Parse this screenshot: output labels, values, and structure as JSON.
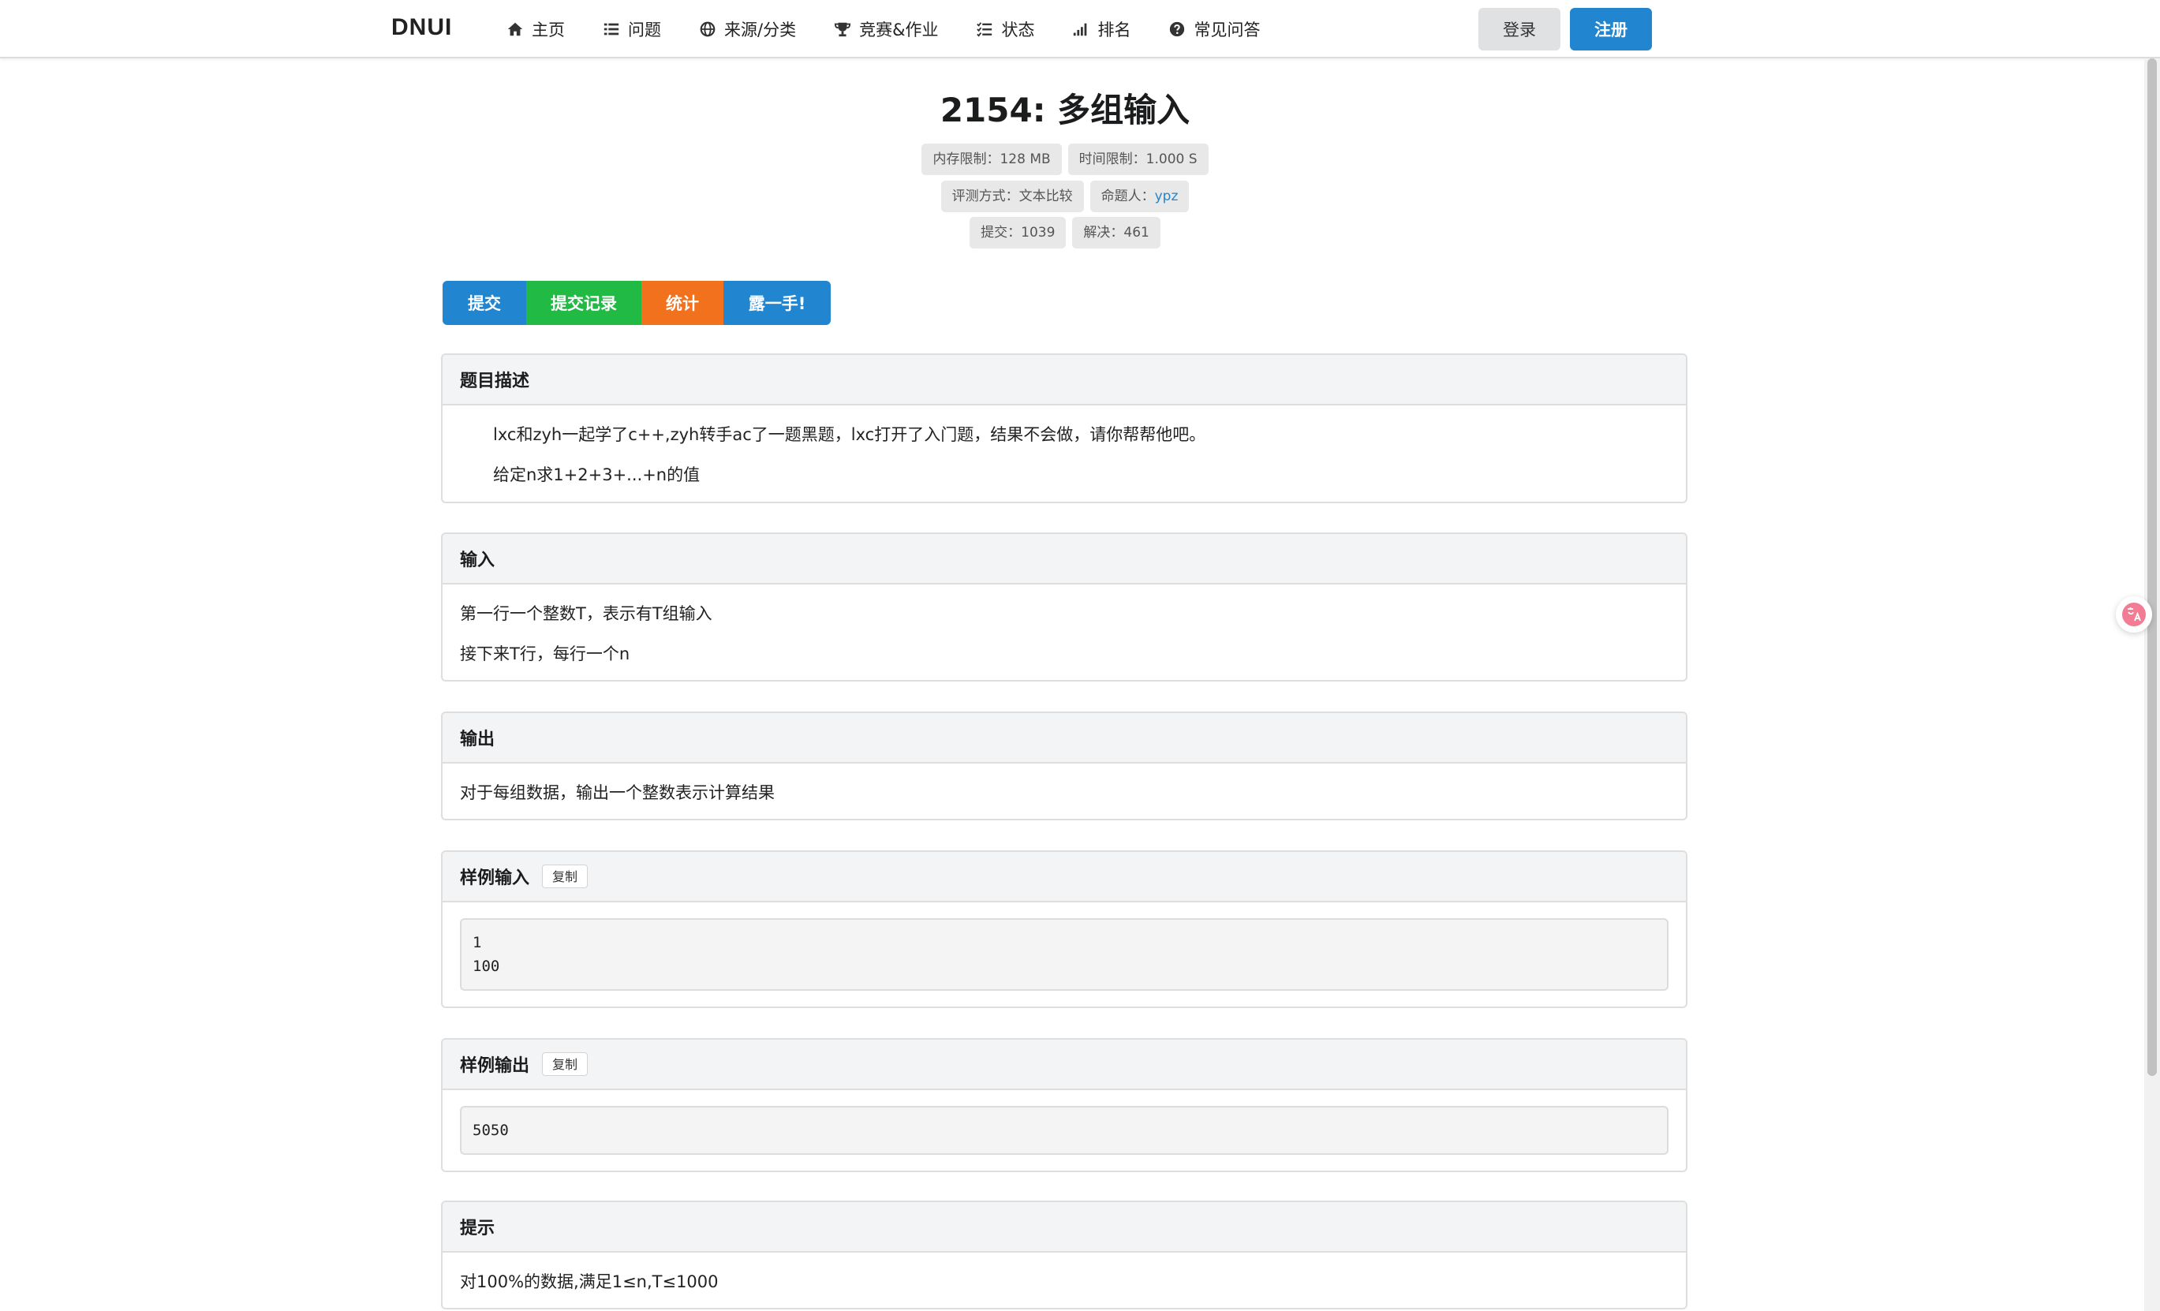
{
  "nav": {
    "brand": "DNUI",
    "items": [
      {
        "label": "主页",
        "icon": "home-icon"
      },
      {
        "label": "问题",
        "icon": "list-icon"
      },
      {
        "label": "来源/分类",
        "icon": "globe-icon"
      },
      {
        "label": "竞赛&作业",
        "icon": "trophy-icon"
      },
      {
        "label": "状态",
        "icon": "tasks-icon"
      },
      {
        "label": "排名",
        "icon": "signal-icon"
      },
      {
        "label": "常见问答",
        "icon": "question-circle-icon"
      }
    ],
    "login": "登录",
    "register": "注册"
  },
  "problem": {
    "title": "2154: 多组输入",
    "memory_limit": "内存限制：128 MB",
    "time_limit": "时间限制：1.000 S",
    "judge_method": "评测方式：文本比较",
    "author_label": "命题人：",
    "author": "ypz",
    "submits": "提交：1039",
    "solved": "解决：461"
  },
  "actions": {
    "submit": "提交",
    "records": "提交记录",
    "stats": "统计",
    "show": "露一手!"
  },
  "sections": {
    "description": {
      "title": "题目描述",
      "lines": [
        "lxc和zyh一起学了c++,zyh转手ac了一题黑题，lxc打开了入门题，结果不会做，请你帮帮他吧。",
        "给定n求1+2+3+...+n的值"
      ]
    },
    "input": {
      "title": "输入",
      "lines": [
        "第一行一个整数T，表示有T组输入",
        "接下来T行，每行一个n"
      ]
    },
    "output": {
      "title": "输出",
      "lines": [
        "对于每组数据，输出一个整数表示计算结果"
      ]
    },
    "sample_input": {
      "title": "样例输入",
      "copy": "复制",
      "lines": [
        "1",
        "100"
      ]
    },
    "sample_output": {
      "title": "样例输出",
      "copy": "复制",
      "lines": [
        "5050"
      ]
    },
    "hint": {
      "title": "提示",
      "lines": [
        "对100%的数据,满足1≤n,T≤1000"
      ]
    }
  },
  "colors": {
    "primary": "#2185d0",
    "green": "#21ba45",
    "orange": "#f2711c"
  }
}
